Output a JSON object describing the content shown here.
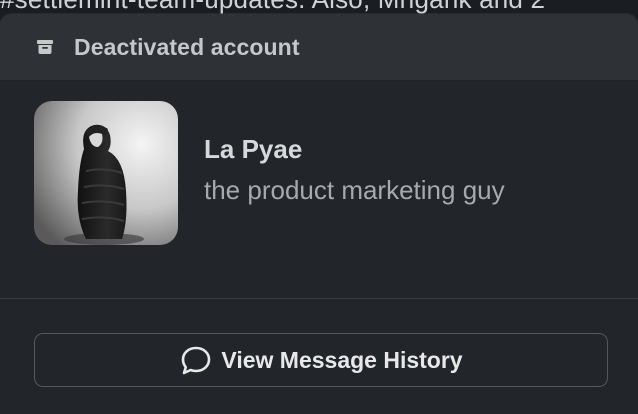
{
  "background": {
    "message_text": "#settlemint-team-updates. Also, Mrigank and 2"
  },
  "popover": {
    "status_icon": "archive-icon",
    "status_label": "Deactivated account",
    "profile": {
      "name": "La Pyae",
      "title": "the product marketing guy",
      "avatar_icon": "avatar-photo"
    },
    "history_button": {
      "icon": "speech-bubble-icon",
      "label": "View Message History"
    }
  },
  "colors": {
    "popover_bg": "#222529",
    "header_bg": "#2e3136",
    "button_border": "#54575b"
  }
}
